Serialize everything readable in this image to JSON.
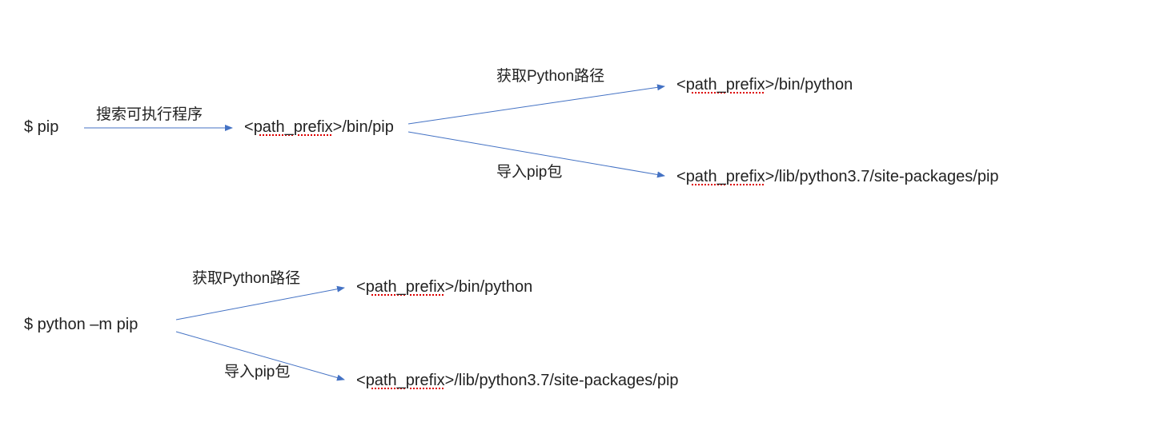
{
  "diagram1": {
    "start": "$ pip",
    "arrow1_label": "搜索可执行程序",
    "mid_node_prefix": "path_prefix",
    "mid_node_suffix": "/bin/pip",
    "arrow2_label": "获取Python路径",
    "arrow3_label": "导入pip包",
    "result1_prefix": "path_prefix",
    "result1_suffix": "/bin/python",
    "result2_prefix": "path_prefix",
    "result2_suffix": "/lib/python3.7/site-packages/pip"
  },
  "diagram2": {
    "start": "$ python –m pip",
    "arrow1_label": "获取Python路径",
    "arrow2_label": "导入pip包",
    "result1_prefix": "path_prefix",
    "result1_suffix": "/bin/python",
    "result2_prefix": "path_prefix",
    "result2_suffix": "/lib/python3.7/site-packages/pip"
  }
}
